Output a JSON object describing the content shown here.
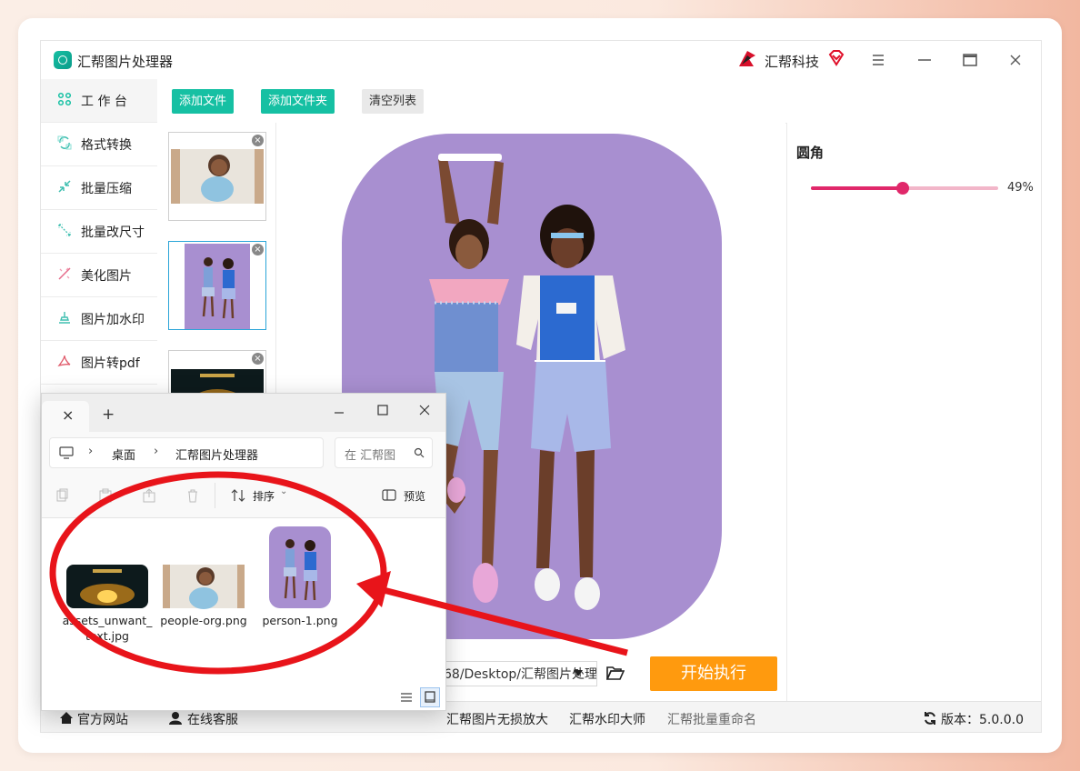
{
  "app": {
    "title": "汇帮图片处理器",
    "brand_name": "汇帮科技"
  },
  "sidebar": {
    "items": [
      {
        "label": "工 作 台",
        "icon": "grid-icon"
      },
      {
        "label": "格式转换",
        "icon": "convert-icon"
      },
      {
        "label": "批量压缩",
        "icon": "compress-icon"
      },
      {
        "label": "批量改尺寸",
        "icon": "resize-icon"
      },
      {
        "label": "美化图片",
        "icon": "beautify-icon"
      },
      {
        "label": "图片加水印",
        "icon": "watermark-icon"
      },
      {
        "label": "图片转pdf",
        "icon": "pdf-icon"
      }
    ]
  },
  "toolbar": {
    "add_file": "添加文件",
    "add_folder": "添加文件夹",
    "clear_list": "清空列表"
  },
  "properties": {
    "title": "圆角",
    "slider_percent": 49,
    "slider_value_label": "49%"
  },
  "output": {
    "path": "68/Desktop/汇帮图片处理器",
    "start_label": "开始执行"
  },
  "statusbar": {
    "website": "官方网站",
    "service": "在线客服",
    "upscale": "汇帮图片无损放大",
    "watermark_master": "汇帮水印大师",
    "batch_rename": "汇帮批量重命名",
    "version": "版本：5.0.0.0"
  },
  "explorer": {
    "tab_close": "×",
    "tab_add": "+",
    "breadcrumb": [
      "桌面",
      "汇帮图片处理器"
    ],
    "search_placeholder": "在 汇帮图",
    "sort_label": "排序",
    "preview_label": "预览",
    "files": [
      {
        "name": "assets_unwant_text.jpg"
      },
      {
        "name": "people-org.png"
      },
      {
        "name": "person-1.png"
      }
    ]
  },
  "colors": {
    "accent_teal": "#16c0a3",
    "start_orange": "#ff9a0e",
    "slider_pink": "#e0286a",
    "annotation_red": "#e8141a",
    "preview_purple": "#a88fd0"
  }
}
